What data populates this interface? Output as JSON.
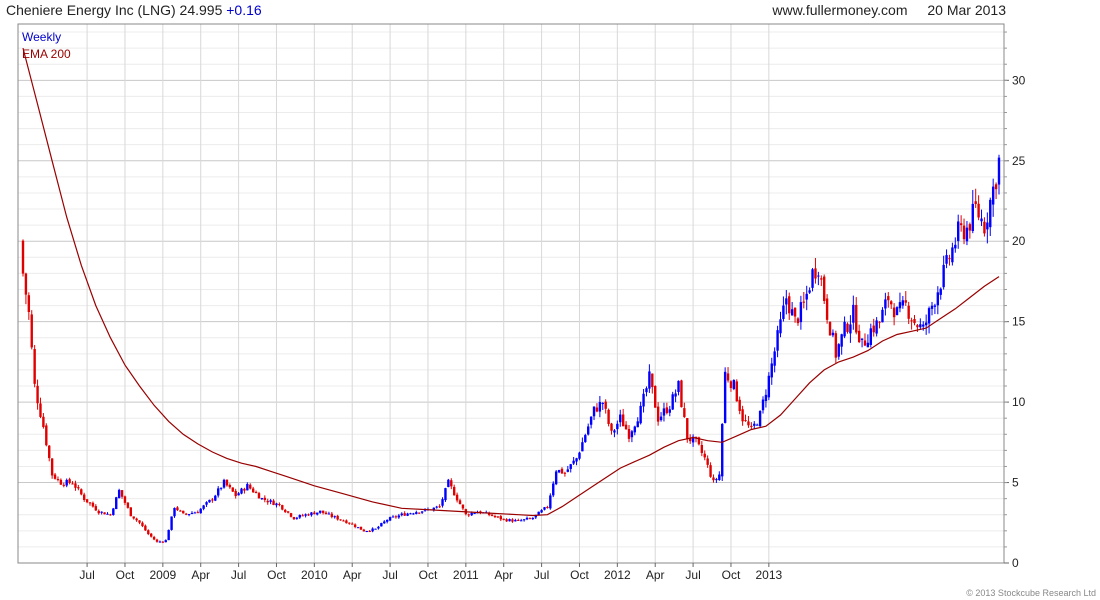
{
  "header": {
    "title": "Cheniere Energy Inc (LNG)",
    "price": "24.995",
    "change": "+0.16",
    "site": "www.fullermoney.com",
    "date": "20 Mar 2013"
  },
  "chart_data": {
    "type": "candlestick",
    "frequency": "Weekly",
    "legend": [
      "Weekly",
      "EMA 200"
    ],
    "x_tick_labels": [
      "Jul",
      "Oct",
      "2009",
      "Apr",
      "Jul",
      "Oct",
      "2010",
      "Apr",
      "Jul",
      "Oct",
      "2011",
      "Apr",
      "Jul",
      "Oct",
      "2012",
      "Apr",
      "Jul",
      "Oct",
      "2013"
    ],
    "ylim": [
      0,
      33.5
    ],
    "y_ticks": [
      0,
      5,
      10,
      15,
      20,
      25,
      30
    ],
    "y_scale": "linear",
    "grid": true,
    "colors": {
      "up": "#0000ff",
      "down": "#e00000",
      "ema": "#990000"
    },
    "close_points": [
      {
        "i": 0,
        "c": 18.0
      },
      {
        "i": 2,
        "c": 15.5
      },
      {
        "i": 4,
        "c": 11.0
      },
      {
        "i": 7,
        "c": 8.5
      },
      {
        "i": 10,
        "c": 5.5
      },
      {
        "i": 13,
        "c": 5.0
      },
      {
        "i": 17,
        "c": 5.0
      },
      {
        "i": 21,
        "c": 4.0
      },
      {
        "i": 26,
        "c": 3.2
      },
      {
        "i": 30,
        "c": 3.0
      },
      {
        "i": 33,
        "c": 4.5
      },
      {
        "i": 37,
        "c": 3.0
      },
      {
        "i": 40,
        "c": 2.5
      },
      {
        "i": 43,
        "c": 1.8
      },
      {
        "i": 46,
        "c": 1.3
      },
      {
        "i": 49,
        "c": 1.4
      },
      {
        "i": 52,
        "c": 3.5
      },
      {
        "i": 55,
        "c": 3.0
      },
      {
        "i": 60,
        "c": 3.2
      },
      {
        "i": 65,
        "c": 4.0
      },
      {
        "i": 69,
        "c": 5.0
      },
      {
        "i": 73,
        "c": 4.2
      },
      {
        "i": 77,
        "c": 4.8
      },
      {
        "i": 82,
        "c": 4.0
      },
      {
        "i": 88,
        "c": 3.6
      },
      {
        "i": 93,
        "c": 2.8
      },
      {
        "i": 97,
        "c": 3.0
      },
      {
        "i": 102,
        "c": 3.2
      },
      {
        "i": 106,
        "c": 2.9
      },
      {
        "i": 112,
        "c": 2.5
      },
      {
        "i": 117,
        "c": 2.0
      },
      {
        "i": 121,
        "c": 2.1
      },
      {
        "i": 125,
        "c": 2.7
      },
      {
        "i": 130,
        "c": 3.0
      },
      {
        "i": 135,
        "c": 3.2
      },
      {
        "i": 139,
        "c": 3.3
      },
      {
        "i": 143,
        "c": 3.5
      },
      {
        "i": 146,
        "c": 5.0
      },
      {
        "i": 149,
        "c": 4.0
      },
      {
        "i": 152,
        "c": 3.0
      },
      {
        "i": 156,
        "c": 3.2
      },
      {
        "i": 160,
        "c": 3.0
      },
      {
        "i": 165,
        "c": 2.7
      },
      {
        "i": 170,
        "c": 2.6
      },
      {
        "i": 175,
        "c": 2.8
      },
      {
        "i": 180,
        "c": 3.5
      },
      {
        "i": 183,
        "c": 5.8
      },
      {
        "i": 186,
        "c": 5.6
      },
      {
        "i": 190,
        "c": 6.5
      },
      {
        "i": 193,
        "c": 8.0
      },
      {
        "i": 196,
        "c": 9.5
      },
      {
        "i": 199,
        "c": 10.0
      },
      {
        "i": 202,
        "c": 8.0
      },
      {
        "i": 205,
        "c": 9.0
      },
      {
        "i": 208,
        "c": 8.0
      },
      {
        "i": 212,
        "c": 9.5
      },
      {
        "i": 215,
        "c": 11.5
      },
      {
        "i": 218,
        "c": 9.0
      },
      {
        "i": 222,
        "c": 9.8
      },
      {
        "i": 225,
        "c": 11.0
      },
      {
        "i": 228,
        "c": 7.8
      },
      {
        "i": 231,
        "c": 7.5
      },
      {
        "i": 234,
        "c": 6.5
      },
      {
        "i": 237,
        "c": 5.0
      },
      {
        "i": 239,
        "c": 5.5
      },
      {
        "i": 241,
        "c": 11.8
      },
      {
        "i": 244,
        "c": 11.0
      },
      {
        "i": 247,
        "c": 9.0
      },
      {
        "i": 250,
        "c": 8.2
      },
      {
        "i": 253,
        "c": 9.2
      },
      {
        "i": 256,
        "c": 11.5
      },
      {
        "i": 259,
        "c": 14.0
      },
      {
        "i": 262,
        "c": 16.5
      },
      {
        "i": 265,
        "c": 15.0
      },
      {
        "i": 268,
        "c": 16.0
      },
      {
        "i": 271,
        "c": 18.0
      },
      {
        "i": 273,
        "c": 18.5
      },
      {
        "i": 276,
        "c": 15.5
      },
      {
        "i": 279,
        "c": 13.0
      },
      {
        "i": 282,
        "c": 14.5
      },
      {
        "i": 285,
        "c": 15.5
      },
      {
        "i": 288,
        "c": 13.5
      },
      {
        "i": 291,
        "c": 14.5
      },
      {
        "i": 294,
        "c": 15.0
      },
      {
        "i": 297,
        "c": 16.5
      },
      {
        "i": 300,
        "c": 15.5
      },
      {
        "i": 303,
        "c": 16.0
      },
      {
        "i": 306,
        "c": 15.0
      },
      {
        "i": 309,
        "c": 14.5
      },
      {
        "i": 312,
        "c": 16.0
      },
      {
        "i": 315,
        "c": 17.5
      },
      {
        "i": 318,
        "c": 19.0
      },
      {
        "i": 321,
        "c": 20.5
      },
      {
        "i": 324,
        "c": 20.8
      },
      {
        "i": 327,
        "c": 22.0
      },
      {
        "i": 330,
        "c": 21.0
      },
      {
        "i": 332,
        "c": 22.5
      },
      {
        "i": 334,
        "c": 24.0
      },
      {
        "i": 335,
        "c": 24.995
      }
    ],
    "ema200": [
      {
        "i": 0,
        "v": 32.0
      },
      {
        "i": 5,
        "v": 28.5
      },
      {
        "i": 10,
        "v": 25.0
      },
      {
        "i": 15,
        "v": 21.5
      },
      {
        "i": 20,
        "v": 18.5
      },
      {
        "i": 25,
        "v": 16.0
      },
      {
        "i": 30,
        "v": 14.0
      },
      {
        "i": 35,
        "v": 12.3
      },
      {
        "i": 40,
        "v": 11.0
      },
      {
        "i": 45,
        "v": 9.8
      },
      {
        "i": 50,
        "v": 8.8
      },
      {
        "i": 55,
        "v": 8.0
      },
      {
        "i": 60,
        "v": 7.4
      },
      {
        "i": 65,
        "v": 6.9
      },
      {
        "i": 70,
        "v": 6.5
      },
      {
        "i": 75,
        "v": 6.2
      },
      {
        "i": 80,
        "v": 6.0
      },
      {
        "i": 85,
        "v": 5.7
      },
      {
        "i": 90,
        "v": 5.4
      },
      {
        "i": 95,
        "v": 5.1
      },
      {
        "i": 100,
        "v": 4.8
      },
      {
        "i": 110,
        "v": 4.3
      },
      {
        "i": 120,
        "v": 3.8
      },
      {
        "i": 130,
        "v": 3.4
      },
      {
        "i": 140,
        "v": 3.3
      },
      {
        "i": 150,
        "v": 3.2
      },
      {
        "i": 160,
        "v": 3.1
      },
      {
        "i": 170,
        "v": 3.0
      },
      {
        "i": 175,
        "v": 2.95
      },
      {
        "i": 180,
        "v": 3.0
      },
      {
        "i": 185,
        "v": 3.5
      },
      {
        "i": 190,
        "v": 4.1
      },
      {
        "i": 195,
        "v": 4.7
      },
      {
        "i": 200,
        "v": 5.3
      },
      {
        "i": 205,
        "v": 5.9
      },
      {
        "i": 210,
        "v": 6.3
      },
      {
        "i": 215,
        "v": 6.7
      },
      {
        "i": 220,
        "v": 7.2
      },
      {
        "i": 225,
        "v": 7.6
      },
      {
        "i": 230,
        "v": 7.8
      },
      {
        "i": 235,
        "v": 7.6
      },
      {
        "i": 240,
        "v": 7.5
      },
      {
        "i": 245,
        "v": 7.9
      },
      {
        "i": 250,
        "v": 8.3
      },
      {
        "i": 255,
        "v": 8.5
      },
      {
        "i": 260,
        "v": 9.2
      },
      {
        "i": 265,
        "v": 10.2
      },
      {
        "i": 270,
        "v": 11.2
      },
      {
        "i": 275,
        "v": 12.0
      },
      {
        "i": 280,
        "v": 12.5
      },
      {
        "i": 285,
        "v": 12.8
      },
      {
        "i": 290,
        "v": 13.2
      },
      {
        "i": 295,
        "v": 13.8
      },
      {
        "i": 300,
        "v": 14.2
      },
      {
        "i": 305,
        "v": 14.4
      },
      {
        "i": 310,
        "v": 14.6
      },
      {
        "i": 315,
        "v": 15.2
      },
      {
        "i": 320,
        "v": 15.8
      },
      {
        "i": 325,
        "v": 16.5
      },
      {
        "i": 330,
        "v": 17.2
      },
      {
        "i": 335,
        "v": 17.8
      }
    ]
  },
  "copyright": "© 2013 Stockcube Research Ltd"
}
